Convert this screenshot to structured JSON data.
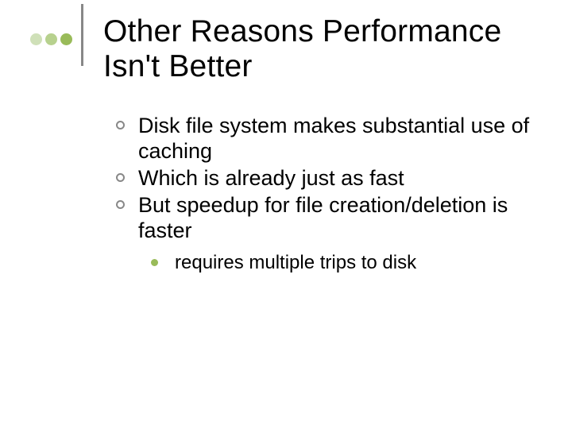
{
  "title": "Other Reasons Performance Isn't Better",
  "bullets": [
    "Disk file system makes substantial use of caching",
    "Which is already just as fast",
    "But speedup for file creation/deletion is faster"
  ],
  "sub": [
    "requires multiple trips to disk"
  ],
  "colors": {
    "accent": "#99bb59",
    "accent_mid": "#b7d18e",
    "accent_pale": "#cfe0b8",
    "rule": "#888888"
  }
}
